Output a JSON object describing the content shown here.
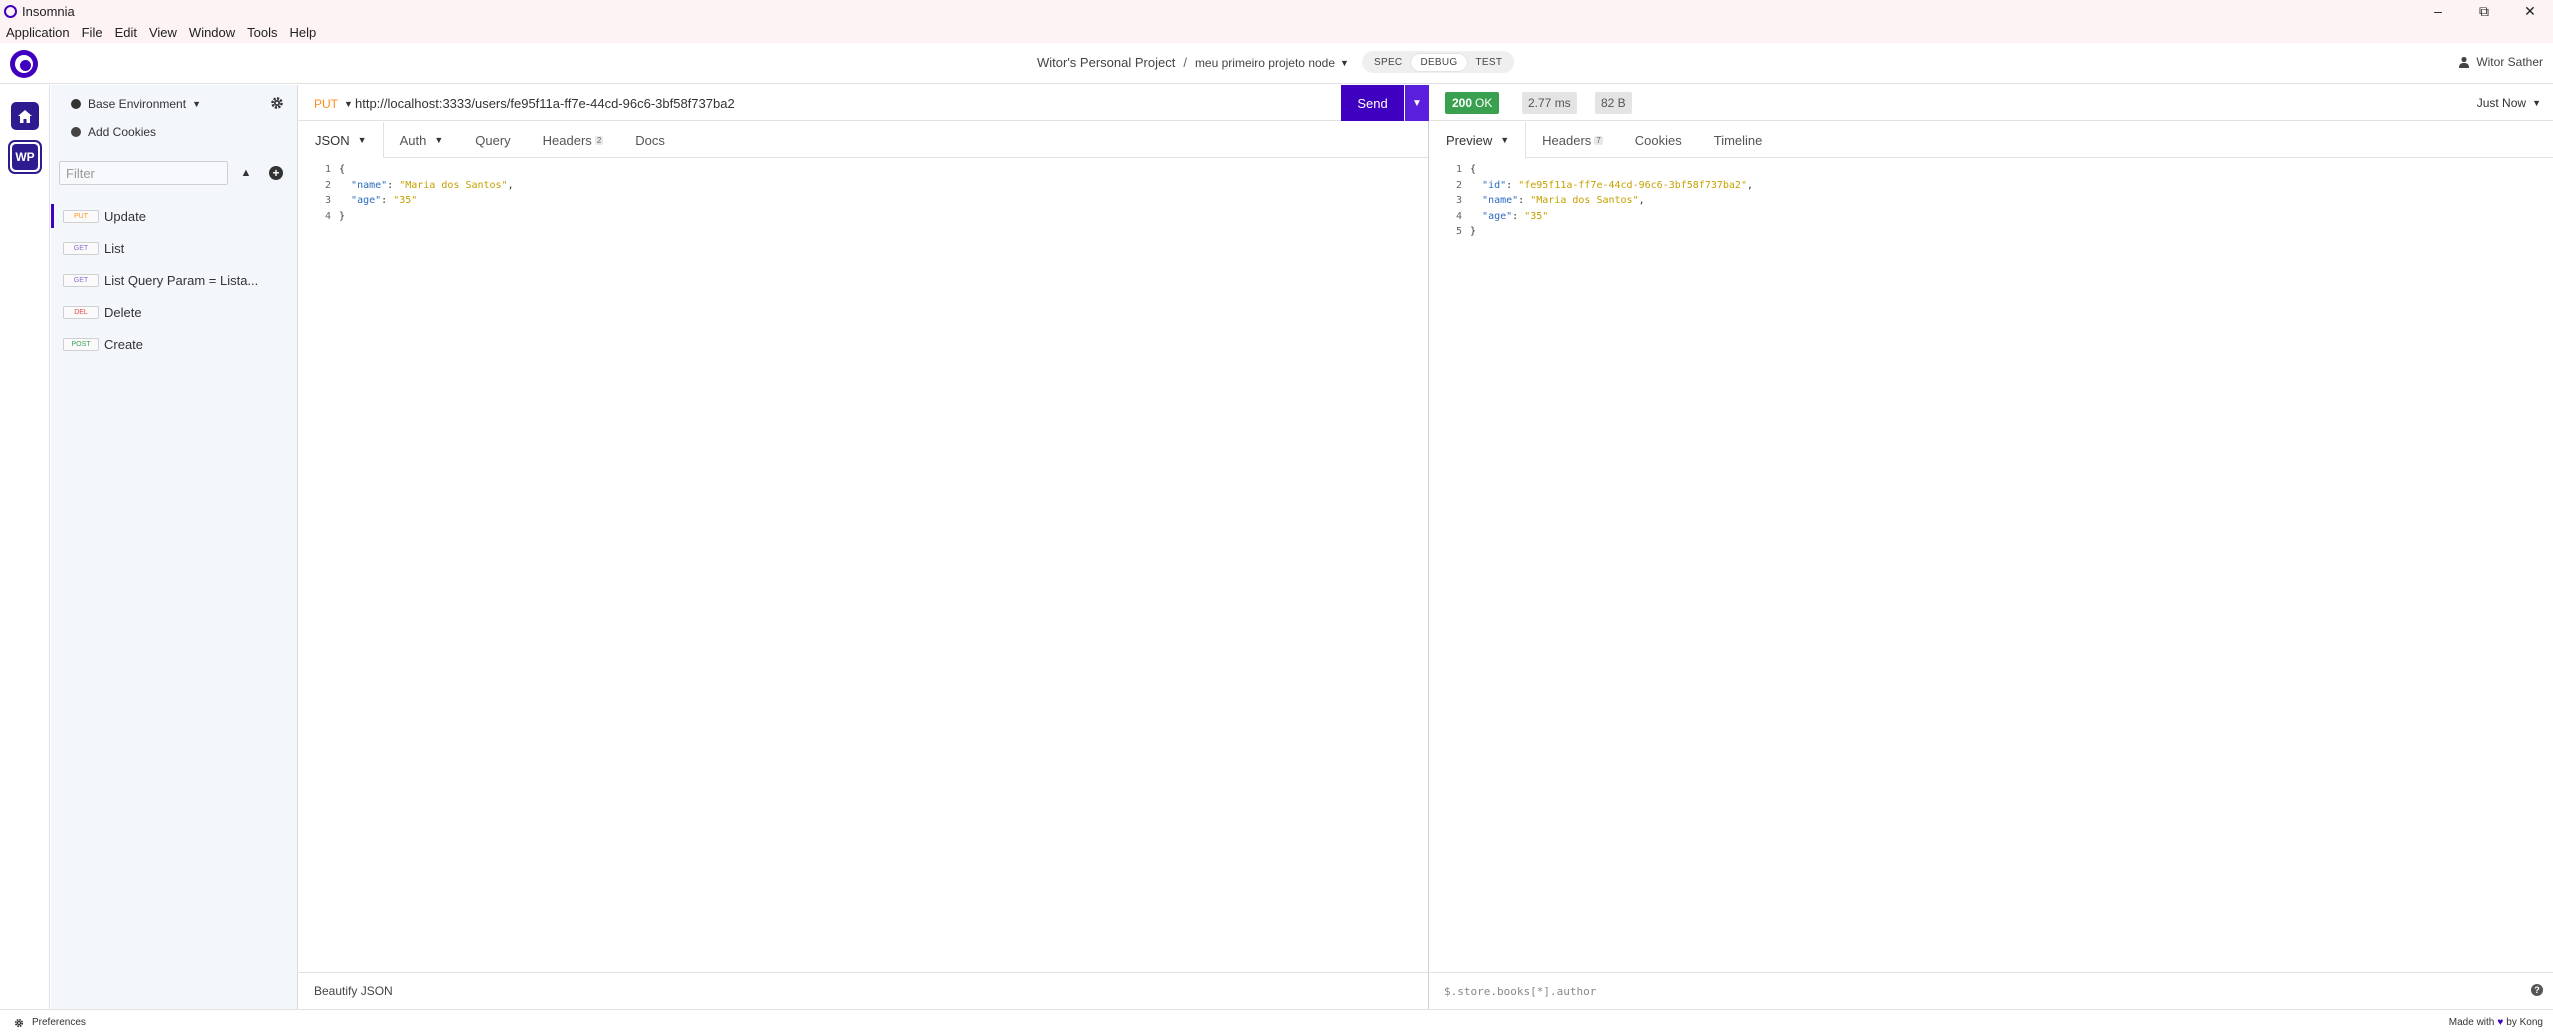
{
  "window": {
    "title": "Insomnia"
  },
  "menu": [
    "Application",
    "File",
    "Edit",
    "View",
    "Window",
    "Tools",
    "Help"
  ],
  "header": {
    "project": "Witor's Personal Project",
    "separator": "/",
    "collection": "meu primeiro projeto node",
    "modes": [
      "SPEC",
      "DEBUG",
      "TEST"
    ],
    "active_mode": "DEBUG",
    "user": "Witor Sather"
  },
  "rail": {
    "workspace_initials": "WP"
  },
  "sidebar": {
    "environment": "Base Environment",
    "add_cookies": "Add Cookies",
    "filter_placeholder": "Filter",
    "requests": [
      {
        "method": "PUT",
        "name": "Update",
        "active": true
      },
      {
        "method": "GET",
        "name": "List",
        "active": false
      },
      {
        "method": "GET",
        "name": "List Query Param = Lista...",
        "active": false
      },
      {
        "method": "DEL",
        "name": "Delete",
        "active": false
      },
      {
        "method": "POST",
        "name": "Create",
        "active": false
      }
    ]
  },
  "request": {
    "method": "PUT",
    "url": "http://localhost:3333/users/fe95f11a-ff7e-44cd-96c6-3bf58f737ba2",
    "send_label": "Send",
    "tabs": {
      "body": "JSON",
      "auth": "Auth",
      "query": "Query",
      "headers": "Headers",
      "headers_count": "2",
      "docs": "Docs"
    },
    "body_lines": [
      {
        "n": "1",
        "text": "{"
      },
      {
        "n": "2",
        "key": "\"name\"",
        "val": "\"Maria dos Santos\"",
        "end": ","
      },
      {
        "n": "3",
        "key": "\"age\"",
        "val": "\"35\"",
        "end": ""
      },
      {
        "n": "4",
        "text": "}"
      }
    ],
    "footer": "Beautify JSON"
  },
  "response": {
    "status_code": "200",
    "status_text": "OK",
    "time": "2.77 ms",
    "size": "82 B",
    "history": "Just Now",
    "tabs": {
      "preview": "Preview",
      "headers": "Headers",
      "headers_count": "7",
      "cookies": "Cookies",
      "timeline": "Timeline"
    },
    "body_lines": [
      {
        "n": "1",
        "text": "{"
      },
      {
        "n": "2",
        "key": "\"id\"",
        "val": "\"fe95f11a-ff7e-44cd-96c6-3bf58f737ba2\"",
        "end": ","
      },
      {
        "n": "3",
        "key": "\"name\"",
        "val": "\"Maria dos Santos\"",
        "end": ","
      },
      {
        "n": "4",
        "key": "\"age\"",
        "val": "\"35\"",
        "end": ""
      },
      {
        "n": "5",
        "text": "}"
      }
    ],
    "filter_placeholder": "$.store.books[*].author"
  },
  "bottom": {
    "preferences": "Preferences",
    "made_with": "Made with",
    "by": "by Kong"
  },
  "colors": {
    "accent": "#4000bf",
    "ok": "#38a04f",
    "put": "#ff8c1a"
  }
}
